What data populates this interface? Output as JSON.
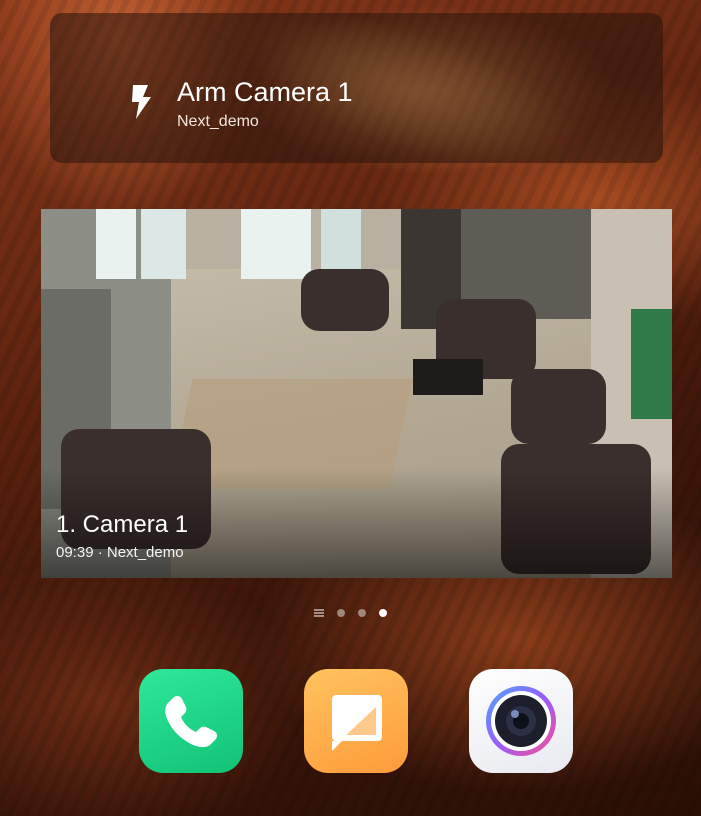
{
  "widget": {
    "icon": "lightning-bolt-icon",
    "title": "Arm Camera 1",
    "subtitle": "Next_demo"
  },
  "camera_feed": {
    "name": "1. Camera 1",
    "info": "09:39 · Next_demo"
  },
  "pager": {
    "pages": 3,
    "active_page": 3
  },
  "dock": {
    "apps": [
      {
        "icon": "phone-icon",
        "color": "#1fd483"
      },
      {
        "icon": "messages-icon",
        "color": "#ffad4a"
      },
      {
        "icon": "camera-icon",
        "color": "#f4f5f8"
      }
    ]
  }
}
